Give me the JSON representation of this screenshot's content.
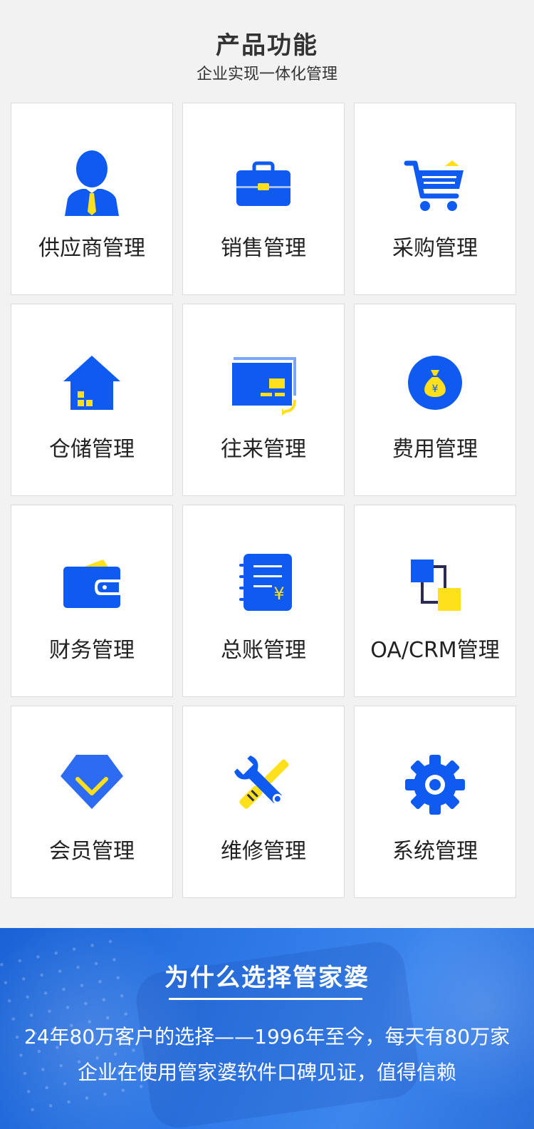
{
  "header": {
    "title": "产品功能",
    "subtitle": "企业实现一体化管理"
  },
  "features": [
    {
      "label": "供应商管理",
      "icon": "supplier-person-icon"
    },
    {
      "label": "销售管理",
      "icon": "briefcase-icon"
    },
    {
      "label": "采购管理",
      "icon": "shopping-cart-icon"
    },
    {
      "label": "仓储管理",
      "icon": "warehouse-house-icon"
    },
    {
      "label": "往来管理",
      "icon": "transaction-card-icon"
    },
    {
      "label": "费用管理",
      "icon": "money-bag-icon"
    },
    {
      "label": "财务管理",
      "icon": "wallet-icon"
    },
    {
      "label": "总账管理",
      "icon": "ledger-notebook-icon"
    },
    {
      "label": "OA/CRM管理",
      "icon": "oa-crm-squares-icon"
    },
    {
      "label": "会员管理",
      "icon": "diamond-icon"
    },
    {
      "label": "维修管理",
      "icon": "wrench-screwdriver-icon"
    },
    {
      "label": "系统管理",
      "icon": "gear-icon"
    }
  ],
  "why": {
    "title": "为什么选择管家婆",
    "text": "24年80万客户的选择——1996年至今，每天有80万家企业在使用管家婆软件口碑见证，值得信赖"
  },
  "colors": {
    "primary_blue": "#0f5bf2",
    "accent_yellow": "#ffe01a",
    "section_blue": "#2f7ae8"
  }
}
